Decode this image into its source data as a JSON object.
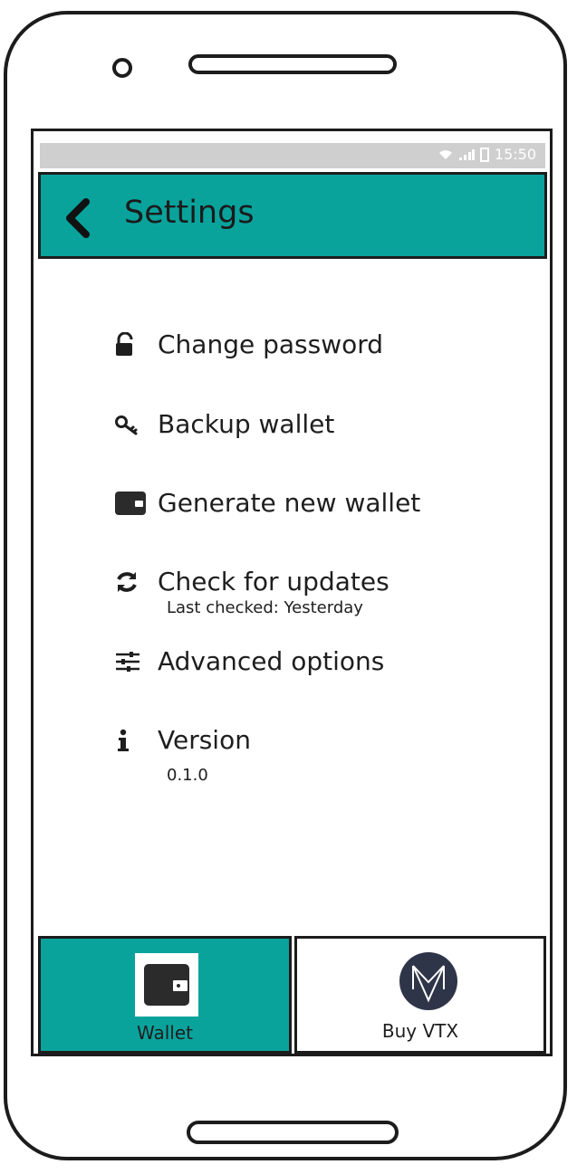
{
  "status_bar": {
    "time": "15:50"
  },
  "header": {
    "title": "Settings"
  },
  "settings": {
    "change_password": "Change password",
    "backup_wallet": "Backup wallet",
    "generate_wallet": "Generate new wallet",
    "check_updates": "Check for updates",
    "last_checked": "Last checked: Yesterday",
    "advanced_options": "Advanced options",
    "version_label": "Version",
    "version_value": "0.1.0"
  },
  "bottom_nav": {
    "wallet": "Wallet",
    "buy_vtx": "Buy VTX"
  },
  "colors": {
    "accent": "#09a39c",
    "status_bar": "#cfcfcf",
    "outline": "#1c1c1c"
  },
  "icons": {
    "back": "chevron-left-icon",
    "change_password": "unlock-icon",
    "backup_wallet": "key-icon",
    "generate_wallet": "wallet-icon",
    "check_updates": "refresh-icon",
    "advanced_options": "sliders-icon",
    "version": "info-icon",
    "buy_vtx": "vtx-logo-icon"
  }
}
